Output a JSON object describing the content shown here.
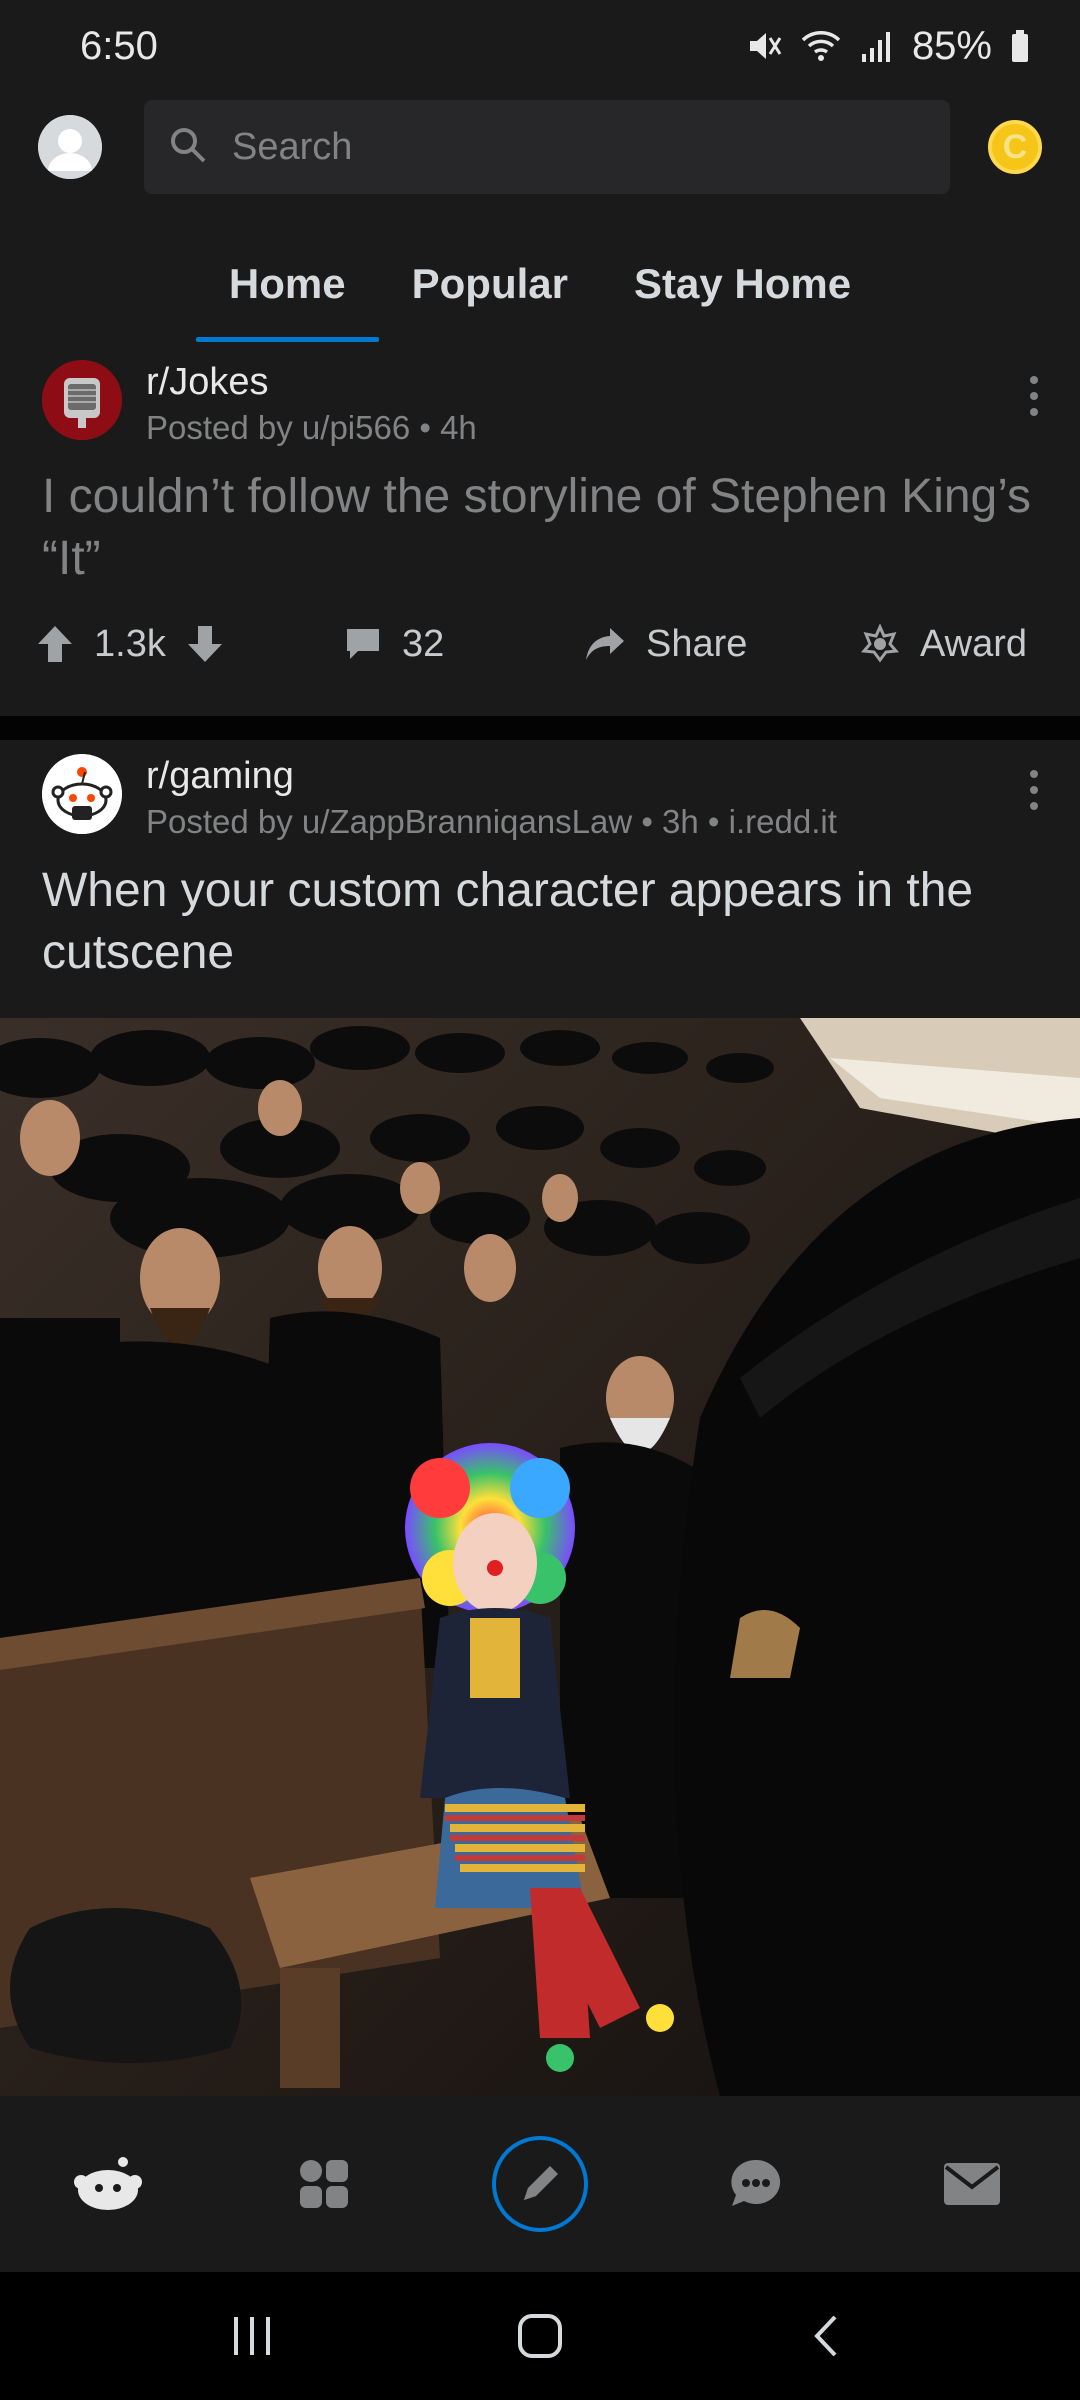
{
  "status_bar": {
    "time": "6:50",
    "battery": "85%",
    "icons": [
      "mute-icon",
      "wifi-icon",
      "signal-icon",
      "battery-icon"
    ]
  },
  "header": {
    "search_placeholder": "Search",
    "icons": [
      "avatar-icon",
      "search-icon",
      "coin-icon"
    ],
    "coin_letter": "C"
  },
  "tabs": [
    {
      "label": "Home",
      "active": true
    },
    {
      "label": "Popular",
      "active": false
    },
    {
      "label": "Stay Home",
      "active": false
    }
  ],
  "posts": [
    {
      "subreddit": "r/Jokes",
      "posted_by": "Posted by u/pi566 • 4h",
      "title": "I couldn’t follow the storyline of Stephen King’s “It”",
      "votes": "1.3k",
      "comments": "32",
      "share_label": "Share",
      "award_label": "Award"
    },
    {
      "subreddit": "r/gaming",
      "posted_by": "Posted by u/ZappBranniqansLaw • 3h • i.redd.it",
      "title": "When your custom character appears in the cutscene",
      "image": "crowd-photo-clown-child"
    }
  ],
  "bottom_nav": [
    "home-icon",
    "communities-icon",
    "create-post-icon",
    "chat-icon",
    "inbox-icon"
  ],
  "system_nav": [
    "recents-icon",
    "home-button-icon",
    "back-icon"
  ],
  "colors": {
    "background": "#1a1a1b",
    "accent": "#0079d3",
    "muted_text": "#818384",
    "coin": "#f5c518"
  }
}
